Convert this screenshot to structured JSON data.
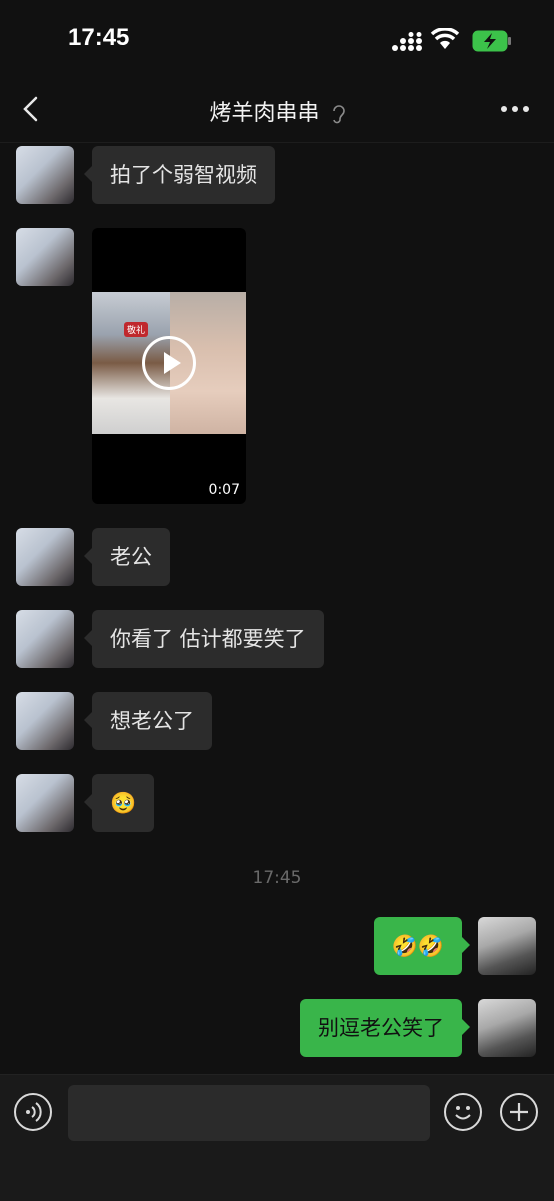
{
  "status_bar": {
    "time": "17:45"
  },
  "header": {
    "title": "烤羊肉串串"
  },
  "messages": {
    "m1": "拍了个弱智视频",
    "video_duration": "0:07",
    "video_sticker": "敬礼",
    "m2": "老公",
    "m3": "你看了 估计都要笑了",
    "m4": "想老公了",
    "m5_emoji": "🥹",
    "timestamp": "17:45",
    "out1_emoji": "🤣🤣",
    "out2": "别逗老公笑了"
  },
  "input": {
    "placeholder": ""
  },
  "colors": {
    "background": "#111111",
    "incoming_bubble": "#2c2c2c",
    "outgoing_bubble": "#39b54a"
  }
}
